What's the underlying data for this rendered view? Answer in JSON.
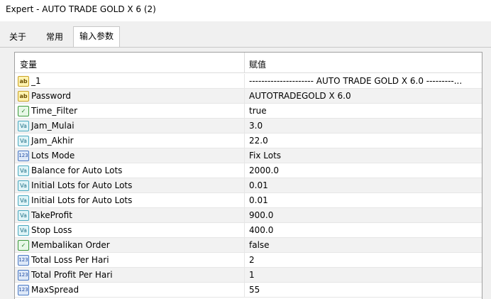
{
  "window": {
    "title": "Expert - AUTO TRADE GOLD X 6 (2)"
  },
  "tabs": [
    {
      "label": "关于",
      "active": false
    },
    {
      "label": "常用",
      "active": false
    },
    {
      "label": "输入参数",
      "active": true
    }
  ],
  "grid": {
    "headers": {
      "variable": "变量",
      "value": "赋值"
    },
    "rows": [
      {
        "icon": "ab",
        "icon_label": "ab",
        "name": "_1",
        "value": "--------------------- AUTO TRADE GOLD X 6.0 ---------..."
      },
      {
        "icon": "ab",
        "icon_label": "ab",
        "name": "Password",
        "value": "AUTOTRADEGOLD X 6.0"
      },
      {
        "icon": "bool",
        "icon_label": "✓",
        "name": "Time_Filter",
        "value": "true"
      },
      {
        "icon": "va",
        "icon_label": "Va",
        "name": "Jam_Mulai",
        "value": "3.0"
      },
      {
        "icon": "va",
        "icon_label": "Va",
        "name": "Jam_Akhir",
        "value": "22.0"
      },
      {
        "icon": "n123",
        "icon_label": "123",
        "name": "Lots Mode",
        "value": "Fix Lots"
      },
      {
        "icon": "va",
        "icon_label": "Va",
        "name": "Balance for Auto Lots",
        "value": "2000.0"
      },
      {
        "icon": "va",
        "icon_label": "Va",
        "name": "Initial Lots for Auto Lots",
        "value": "0.01"
      },
      {
        "icon": "va",
        "icon_label": "Va",
        "name": "Initial Lots for Auto Lots",
        "value": "0.01"
      },
      {
        "icon": "va",
        "icon_label": "Va",
        "name": "TakeProfit",
        "value": "900.0"
      },
      {
        "icon": "va",
        "icon_label": "Va",
        "name": "Stop Loss",
        "value": "400.0"
      },
      {
        "icon": "bool",
        "icon_label": "✓",
        "name": "Membalikan Order",
        "value": "false"
      },
      {
        "icon": "n123",
        "icon_label": "123",
        "name": "Total Loss Per Hari",
        "value": "2"
      },
      {
        "icon": "n123",
        "icon_label": "123",
        "name": "Total Profit Per Hari",
        "value": "1"
      },
      {
        "icon": "n123",
        "icon_label": "123",
        "name": "MaxSpread",
        "value": "55"
      }
    ]
  }
}
